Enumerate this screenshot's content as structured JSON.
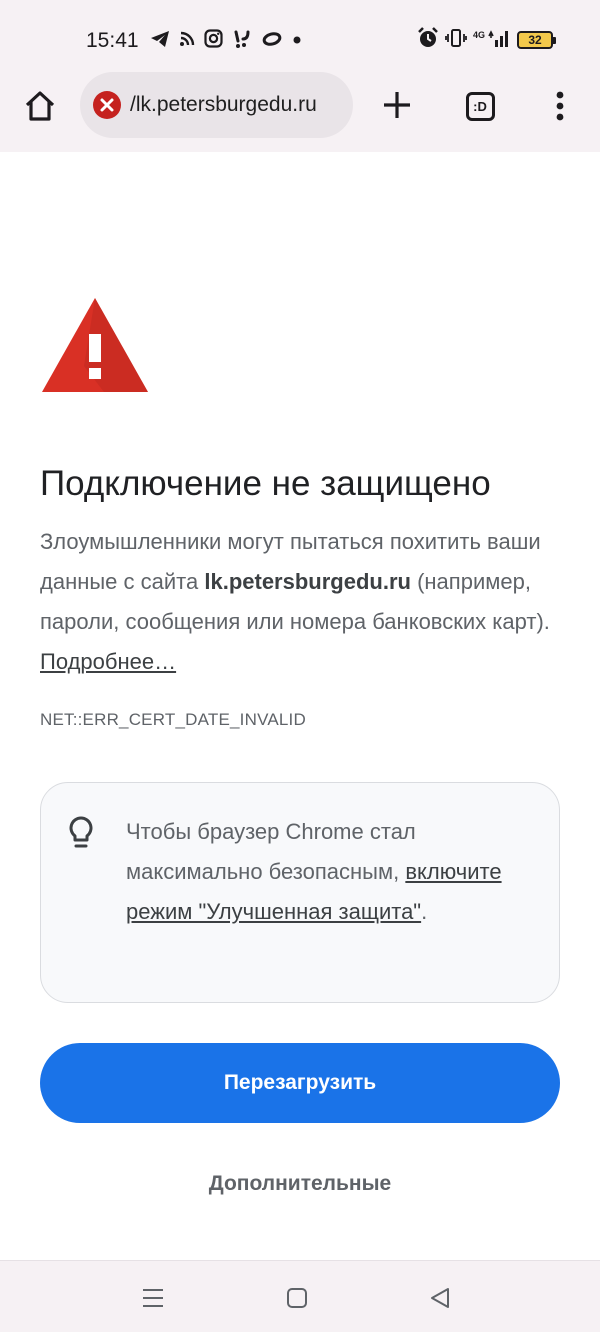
{
  "status_bar": {
    "time": "15:41",
    "left_icons": [
      "telegram-icon",
      "rss-icon",
      "instagram-icon",
      "app-icon",
      "app-ring-icon",
      "dot-icon"
    ],
    "network": "4G",
    "battery": "32"
  },
  "toolbar": {
    "url": "/lk.petersburgedu.ru",
    "tab_count": ":D",
    "icons": [
      "home-icon",
      "not-secure-icon",
      "new-tab-icon",
      "tab-switcher-icon",
      "more-menu-icon"
    ]
  },
  "page": {
    "heading": "Подключение не защищено",
    "explanation_prefix": "Злоумышленники могут пытаться похитить ваши данные с сайта",
    "domain": "lk.petersburgedu.ru",
    "explanation_suffix": "(например, пароли, сообщения или номера банковских карт).",
    "learn_more": "Подробнее…",
    "error_code": "NET::ERR_CERT_DATE_INVALID",
    "tip_prefix": "Чтобы браузер Chrome стал максимально безопасным,",
    "tip_link": "включите режим \"Улучшенная защита\"",
    "tip_suffix": ".",
    "reload_button": "Перезагрузить",
    "advanced_button": "Дополнительные"
  },
  "colors": {
    "accent": "#1a73e8",
    "warning": "#d93025",
    "text": "#202124",
    "secondary_text": "#5f6368"
  }
}
